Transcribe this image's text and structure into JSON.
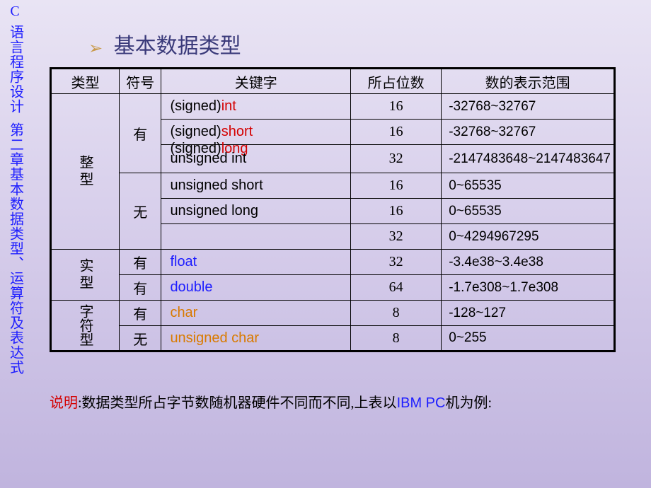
{
  "sidebar": {
    "c": "C",
    "line1": "语言程序设计",
    "line2": "第二章基本数据类型、运算符及表达式"
  },
  "title": "基本数据类型",
  "headers": {
    "type": "类型",
    "sign": "符号",
    "keyword": "关键字",
    "bits": "所占位数",
    "range": "数的表示范围"
  },
  "types": {
    "int": "整型",
    "real": "实型",
    "char": "字符型"
  },
  "signs": {
    "yes": "有",
    "no": "无"
  },
  "rows": {
    "r1": {
      "kw_pre": "(signed)",
      "kw": "int",
      "bits": "16",
      "range": "-32768~32767"
    },
    "r2": {
      "kw_pre": "(signed)",
      "kw": "short",
      "bits": "16",
      "range": "-32768~32767"
    },
    "r3": {
      "kw_pre": "(signed)",
      "kw": "long",
      "bits": "32",
      "range": "-2147483648~2147483647"
    },
    "r3b": {
      "kw": "unsigned  int"
    },
    "r4": {
      "kw": "unsigned  short",
      "bits": "16",
      "range": "0~65535"
    },
    "r5": {
      "kw": "unsigned  long",
      "bits": "16",
      "range": "0~65535"
    },
    "r6": {
      "bits": "32",
      "range": "0~4294967295"
    },
    "r7": {
      "kw": "float",
      "bits": "32",
      "range": "-3.4e38~3.4e38"
    },
    "r8": {
      "kw": "double",
      "bits": "64",
      "range": "-1.7e308~1.7e308"
    },
    "r9": {
      "kw": "char",
      "bits": "8",
      "range": "-128~127"
    },
    "r10": {
      "kw": "unsigned char",
      "bits": "8",
      "range": "0~255"
    }
  },
  "note": {
    "label": "说明",
    "text": ":数据类型所占字节数随机器硬件不同而不同,上表以",
    "ibm": "IBM PC",
    "tail": "机为例:"
  }
}
